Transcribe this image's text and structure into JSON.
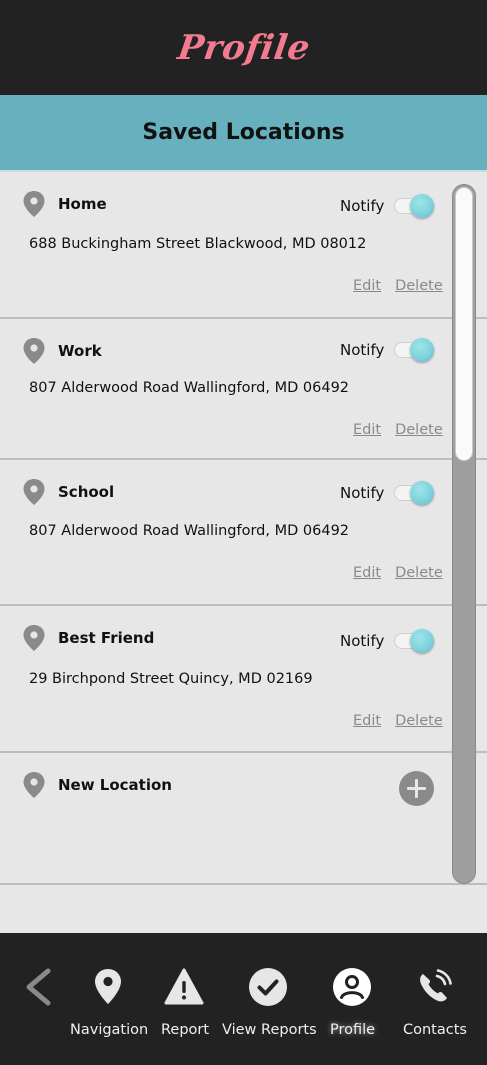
{
  "header": {
    "title": "Profile"
  },
  "section": {
    "title": "Saved Locations"
  },
  "locations": [
    {
      "name": "Home",
      "address": "688 Buckingham Street Blackwood, MD 08012",
      "notify_label": "Notify",
      "notify_on": true,
      "edit_label": "Edit",
      "delete_label": "Delete"
    },
    {
      "name": "Work",
      "address": "807 Alderwood Road Wallingford, MD 06492",
      "notify_label": "Notify",
      "notify_on": true,
      "edit_label": "Edit",
      "delete_label": "Delete"
    },
    {
      "name": "School",
      "address": "807 Alderwood Road Wallingford, MD 06492",
      "notify_label": "Notify",
      "notify_on": true,
      "edit_label": "Edit",
      "delete_label": "Delete"
    },
    {
      "name": "Best Friend",
      "address": "29 Birchpond Street Quincy, MD 02169",
      "notify_label": "Notify",
      "notify_on": true,
      "edit_label": "Edit",
      "delete_label": "Delete"
    }
  ],
  "new_location": {
    "label": "New Location",
    "icon": "plus-circle-icon"
  },
  "nav": {
    "items": [
      {
        "label": "",
        "icon": "back-chevron-icon"
      },
      {
        "label": "Navigation",
        "icon": "map-pin-icon"
      },
      {
        "label": "Report",
        "icon": "warning-icon"
      },
      {
        "label": "View Reports",
        "icon": "check-circle-icon"
      },
      {
        "label": "Profile",
        "icon": "user-icon",
        "active": true
      },
      {
        "label": "Contacts",
        "icon": "phone-icon"
      }
    ]
  },
  "colors": {
    "header_bg": "#222222",
    "title_pink": "#f27b8f",
    "section_teal": "#67b1bf",
    "toggle_on": "#7fd3dd",
    "card_bg": "#e7e7e7"
  }
}
